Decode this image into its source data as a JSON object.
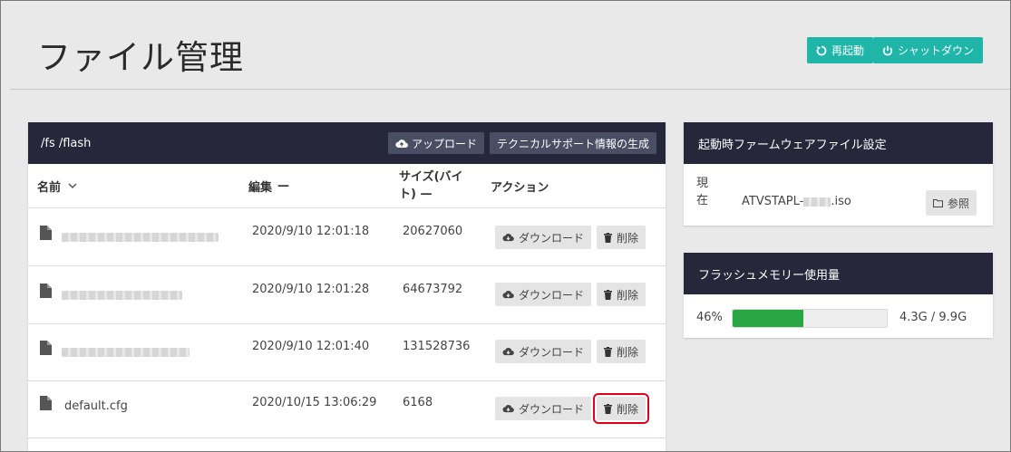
{
  "page_title": "ファイル管理",
  "header_actions": {
    "restart_label": "再起動",
    "shutdown_label": "シャットダウン"
  },
  "files": {
    "path": "/fs /flash",
    "upload_label": "アップロード",
    "tech_support_label": "テクニカルサポート情報の生成",
    "columns": {
      "name": "名前",
      "edited": "編集",
      "size_line1": "サイズ(バイ",
      "size_line2": "ト)",
      "action": "アクション"
    },
    "sort_dash": "—",
    "rows": [
      {
        "name": "",
        "edited": "2020/9/10 12:01:18",
        "size": "20627060",
        "download": "ダウンロード",
        "delete": "削除"
      },
      {
        "name": "",
        "edited": "2020/9/10 12:01:28",
        "size": "64673792",
        "download": "ダウンロード",
        "delete": "削除"
      },
      {
        "name": "",
        "edited": "2020/9/10 12:01:40",
        "size": "131528736",
        "download": "ダウンロード",
        "delete": "削除"
      },
      {
        "name": "default.cfg",
        "edited": "2020/10/15 13:06:29",
        "size": "6168",
        "download": "ダウンロード",
        "delete": "削除"
      }
    ]
  },
  "boot_firmware": {
    "title": "起動時ファームウェアファイル設定",
    "current_label_1": "現",
    "current_label_2": "在",
    "file_prefix": "ATVSTAPL-",
    "file_suffix": ".iso",
    "browse_label": "参照"
  },
  "flash_usage": {
    "title": "フラッシュメモリー使用量",
    "percent_text": "46%",
    "fraction": 0.46,
    "usage_text": "4.3G / 9.9G"
  },
  "colors": {
    "accent": "#1fb5a8",
    "header_dark": "#26273a",
    "progress": "#29a745",
    "highlight": "#e0001b"
  }
}
